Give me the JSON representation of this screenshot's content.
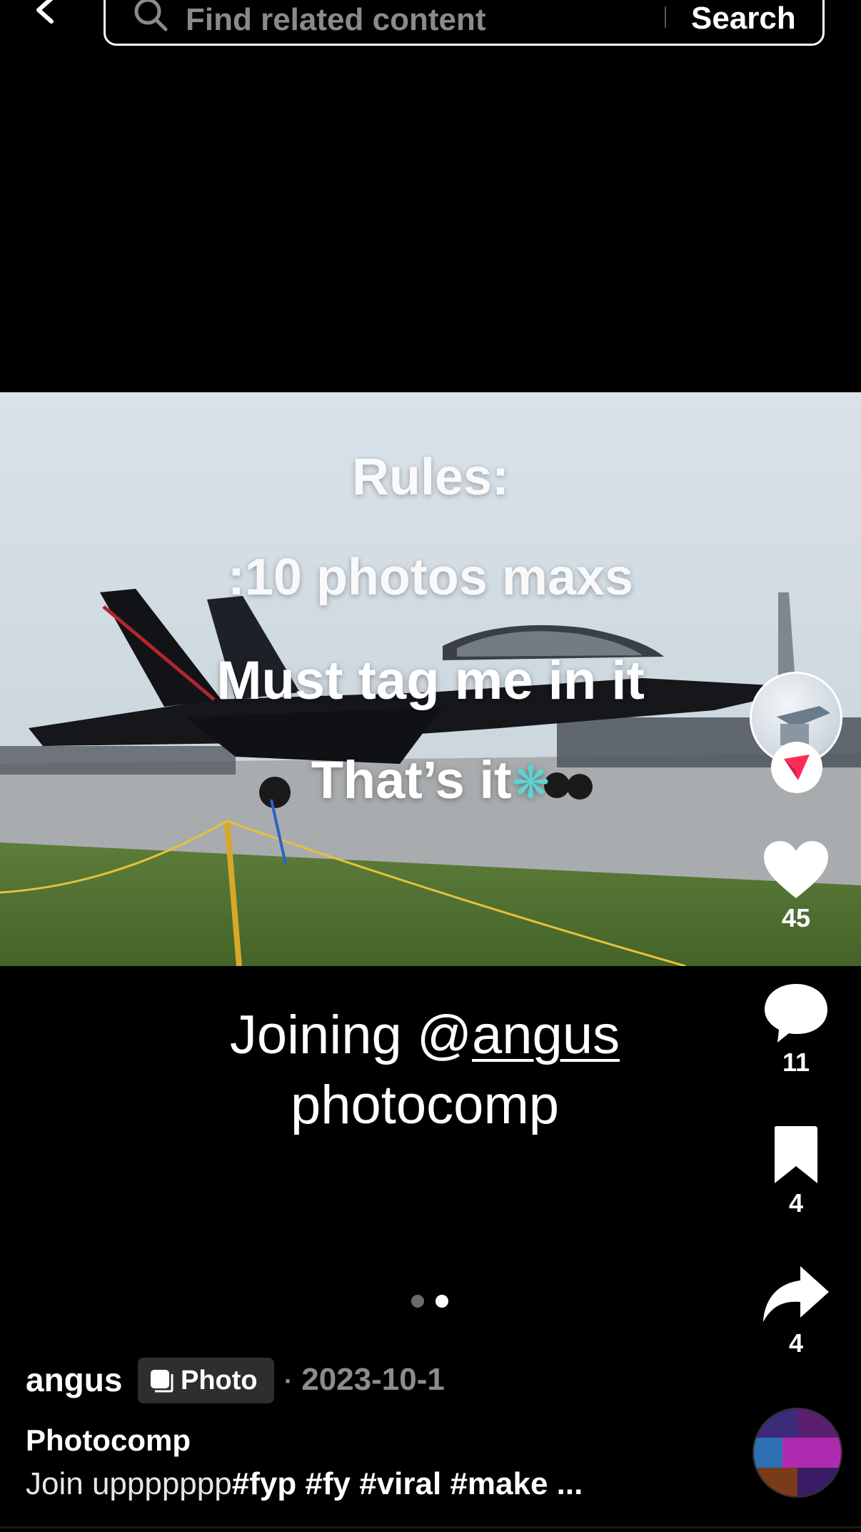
{
  "header": {
    "search_placeholder": "Find related content",
    "search_button": "Search"
  },
  "photo_overlay": {
    "line1": "Rules:",
    "line2": ":10 photos maxs",
    "line3": "Must tag me in it",
    "line4": "That’s it"
  },
  "caption": {
    "prefix": "Joining @",
    "mention": "angus",
    "suffix": "photocomp"
  },
  "pagination": {
    "total": 2,
    "active_index": 2
  },
  "actions": {
    "likes": "45",
    "comments": "11",
    "saves": "4",
    "shares": "4"
  },
  "post": {
    "author": "angus",
    "type_badge": "Photo",
    "date_separator": "·",
    "date": "2023-10-1",
    "title": "Photocomp",
    "description_plain": "Join uppppppp",
    "description_tags": "#fyp #fy #viral #make ..."
  },
  "colors": {
    "background": "#000000",
    "accent_follow": "#fe2c55",
    "muted_text": "#8c8c8c",
    "badge_bg": "#2e2e2e"
  },
  "icons": {
    "back": "chevron-left-icon",
    "search": "search-icon",
    "like": "heart-icon",
    "comment": "comment-bubble-icon",
    "save": "bookmark-icon",
    "share": "share-arrow-icon",
    "follow": "follow-check-icon",
    "badge": "photo-icon"
  }
}
